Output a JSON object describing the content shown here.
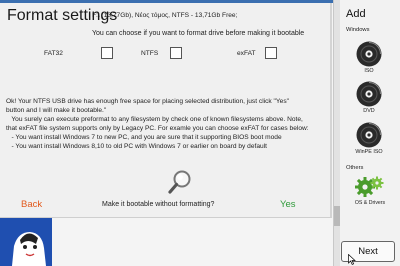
{
  "dialog": {
    "title": "Format settings",
    "drive_info": "F:\\ (13,77Gb), Νέος τόμος, NTFS - 13,71Gb Free;",
    "choose_text": "You can choose if you want to format drive before making it bootable",
    "fs_options": [
      {
        "label": "FAT32",
        "checked": false
      },
      {
        "label": "NTFS",
        "checked": false
      },
      {
        "label": "exFAT",
        "checked": false
      }
    ],
    "message_lines": [
      "Ok! Your NTFS USB drive has enough free space for placing selected distribution, just click \"Yes\"",
      "button and I will make it bootable.\"",
      "   You surely can execute preformat to any filesystem by check one of known filesystems above. Note,",
      "that exFAT file system supports only by Legacy PC. For examle you can choose exFAT for cases below:",
      "   - You want install Windows 7 to new PC, and you are sure that it supporting BIOS boot mode",
      "   - You want install Windows 8,10 to old PC with Windows 7 or earlier on board by default"
    ],
    "prompt": "Make it bootable without formatting?",
    "back_label": "Back",
    "yes_label": "Yes",
    "search_icon": "magnifier-icon"
  },
  "sidebar": {
    "add_label": "Add",
    "windows_label": "Windows",
    "items": [
      {
        "label": "ISO",
        "icon": "disc-icon"
      },
      {
        "label": "DVD",
        "icon": "disc-icon"
      },
      {
        "label": "WinPE ISO",
        "icon": "disc-icon"
      }
    ],
    "others_label": "Others",
    "os_drivers_label": "OS & Drivers",
    "os_drivers_icon": "gears-icon",
    "next_label": "Next"
  },
  "colors": {
    "back": "#e2591c",
    "yes": "#2f9a3a",
    "accent_strip": "#1f4fb0"
  }
}
